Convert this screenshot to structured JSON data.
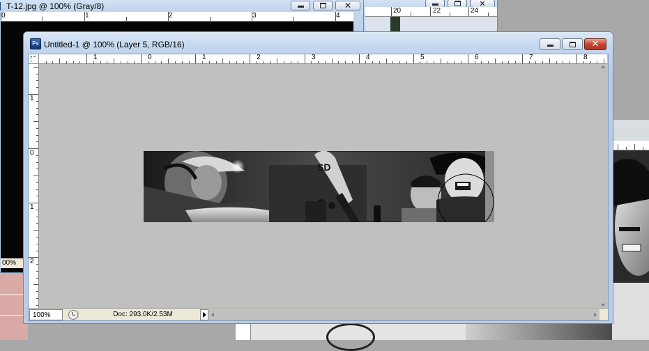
{
  "windows": {
    "back_left": {
      "title": "T-12.jpg @ 100% (Gray/8)",
      "ruler_numbers": [
        "0",
        "1",
        "2",
        "3",
        "4"
      ],
      "zoom": "00%"
    },
    "back_right": {
      "ruler_numbers": [
        "20",
        "22",
        "24"
      ]
    },
    "front": {
      "title": "Untitled-1 @ 100% (Layer 5, RGB/16)",
      "app_icon": "Ps",
      "ruler_h_numbers": [
        "1",
        "0",
        "1",
        "2",
        "3",
        "4",
        "5",
        "6",
        "7",
        "8"
      ],
      "ruler_v_numbers": [
        "1",
        "0",
        "1",
        "2"
      ],
      "zoom_value": "100%",
      "doc_info": "Doc: 293.0K/2.53M",
      "canvas_bg": "#c0c0c0"
    }
  },
  "colors": {
    "desktop": "#a8a8a8",
    "titlebar": "#c4d7ee",
    "close_red": "#c2402a"
  }
}
